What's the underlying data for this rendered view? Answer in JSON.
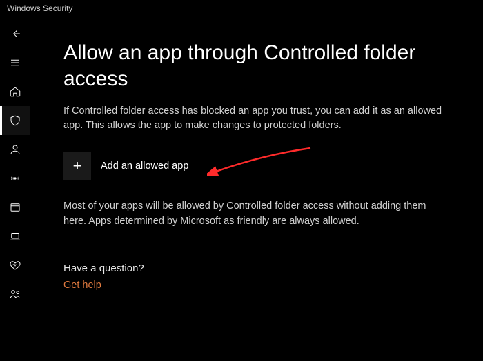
{
  "window": {
    "title": "Windows Security"
  },
  "sidebar": {
    "items": [
      {
        "name": "back"
      },
      {
        "name": "menu"
      },
      {
        "name": "home"
      },
      {
        "name": "virus-threat",
        "selected": true
      },
      {
        "name": "account"
      },
      {
        "name": "firewall"
      },
      {
        "name": "app-browser"
      },
      {
        "name": "device-security"
      },
      {
        "name": "device-performance"
      },
      {
        "name": "family"
      }
    ]
  },
  "page": {
    "title": "Allow an app through Controlled folder access",
    "description": "If Controlled folder access has blocked an app you trust, you can add it as an allowed app. This allows the app to make changes to protected folders.",
    "add_button_label": "Add an allowed app",
    "info_text": "Most of your apps will be allowed by Controlled folder access without adding them here. Apps determined by Microsoft as friendly are always allowed.",
    "question_heading": "Have a question?",
    "help_link": "Get help"
  },
  "annotation": {
    "arrow_color": "#ff2b2b"
  }
}
